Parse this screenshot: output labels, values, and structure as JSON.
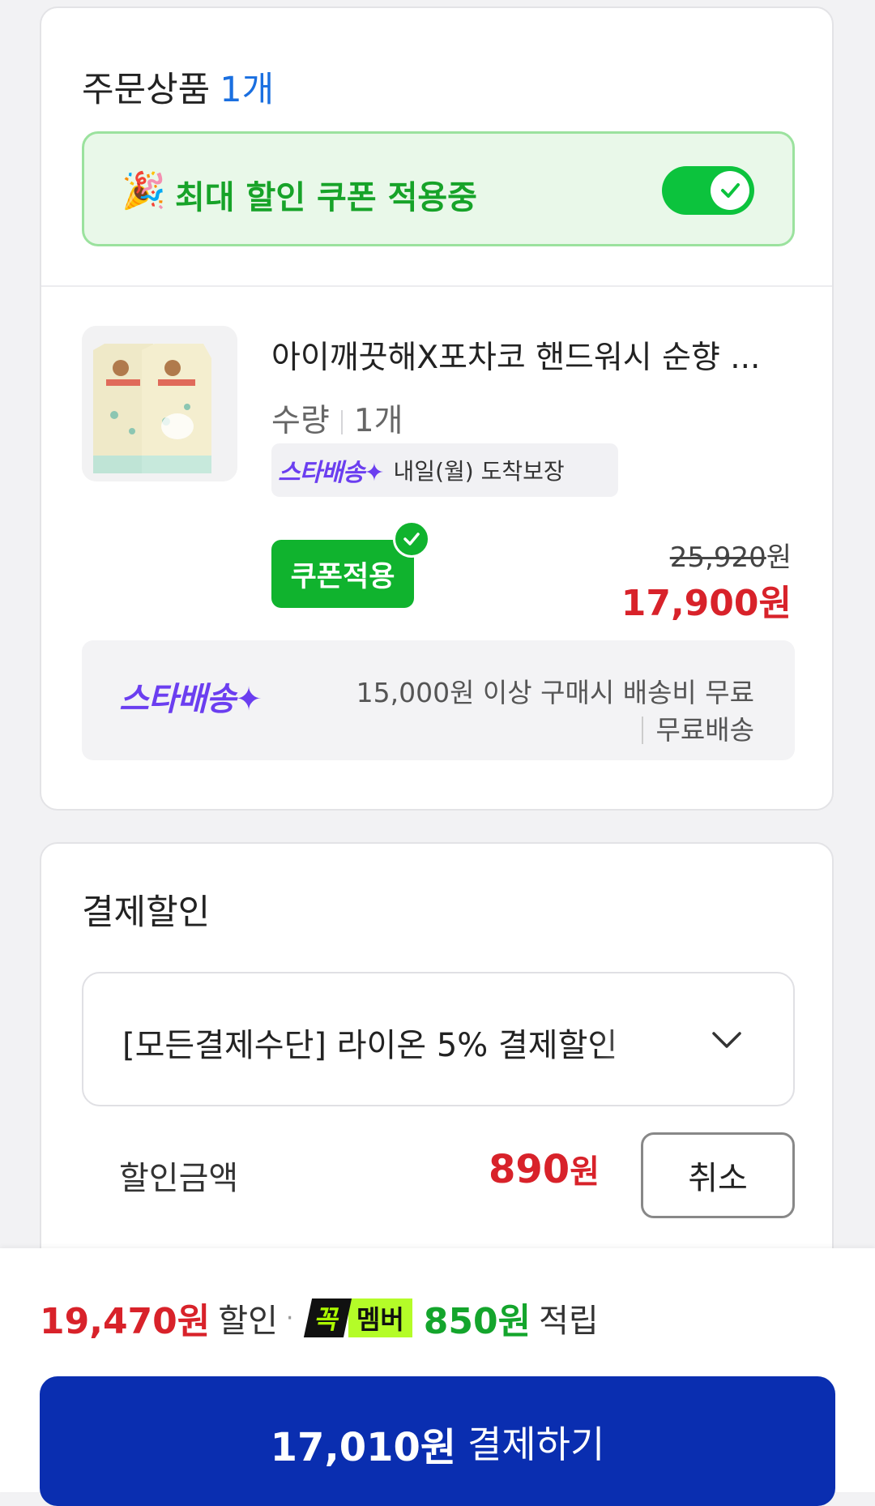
{
  "order": {
    "title": "주문상품",
    "count": "1개",
    "coupon_banner": {
      "label": "최대 할인 쿠폰 적용중",
      "toggle_on": true
    },
    "product": {
      "name": "아이깨끗해X포차코 핸드워시 순향 ...",
      "qty_label": "수량",
      "qty_value": "1개",
      "delivery_brand": "스타배송",
      "delivery_text": "내일(월) 도착보장",
      "coupon_button": "쿠폰적용",
      "original_price": "25,920",
      "original_unit": "원",
      "sale_price": "17,900원"
    },
    "shipping": {
      "brand": "스타배송",
      "line1": "15,000원 이상 구매시 배송비 무료",
      "line2": "무료배송"
    }
  },
  "payment_discount": {
    "title": "결제할인",
    "selected": "[모든결제수단] 라이온 5% 결제할인",
    "amount_label": "할인금액",
    "amount": "890",
    "amount_unit": "원",
    "cancel": "취소"
  },
  "bottom": {
    "discount": "19,470원",
    "discount_word": "할인",
    "badge_a": "꼭",
    "badge_b": "멤버",
    "earn": "850원",
    "earn_word": "적립",
    "pay_amount": "17,010원",
    "pay_text": "결제하기"
  },
  "colors": {
    "accent_blue": "#0a2eb0",
    "sale_red": "#d8222a",
    "coupon_green": "#10b32e",
    "star_purple": "#6b3ef0"
  },
  "icons": [
    "party-popper-icon",
    "checkmark-icon",
    "chevron-down-icon"
  ]
}
